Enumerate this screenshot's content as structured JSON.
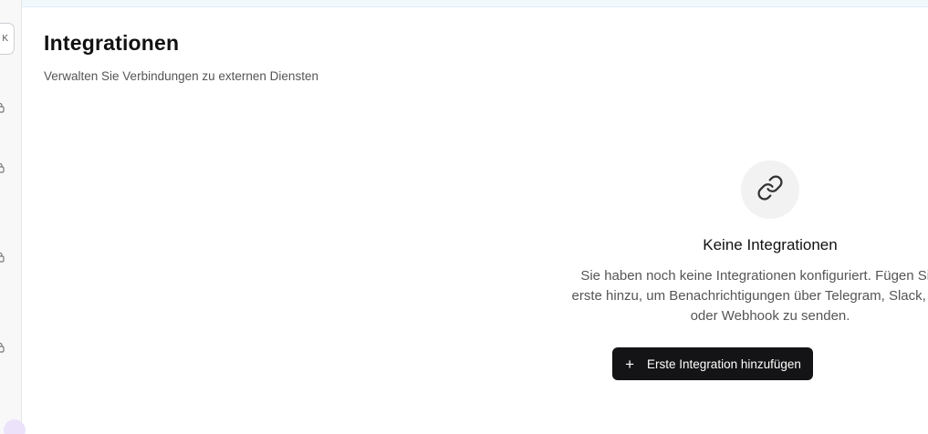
{
  "sidebar": {
    "shortcut_hint": "K",
    "icons": [
      "lock-icon",
      "lock-icon",
      "lock-icon",
      "lock-icon"
    ]
  },
  "header": {
    "title": "Integrationen",
    "subtitle": "Verwalten Sie Verbindungen zu externen Diensten"
  },
  "empty_state": {
    "icon": "link-icon",
    "title": "Keine Integrationen",
    "text": "Sie haben noch keine Integrationen konfiguriert. Fügen Sie die erste hinzu, um Benachrichtigungen über Telegram, Slack, E-Mail oder Webhook zu senden.",
    "button_label": "Erste Integration hinzufügen",
    "button_icon": "plus-icon"
  }
}
